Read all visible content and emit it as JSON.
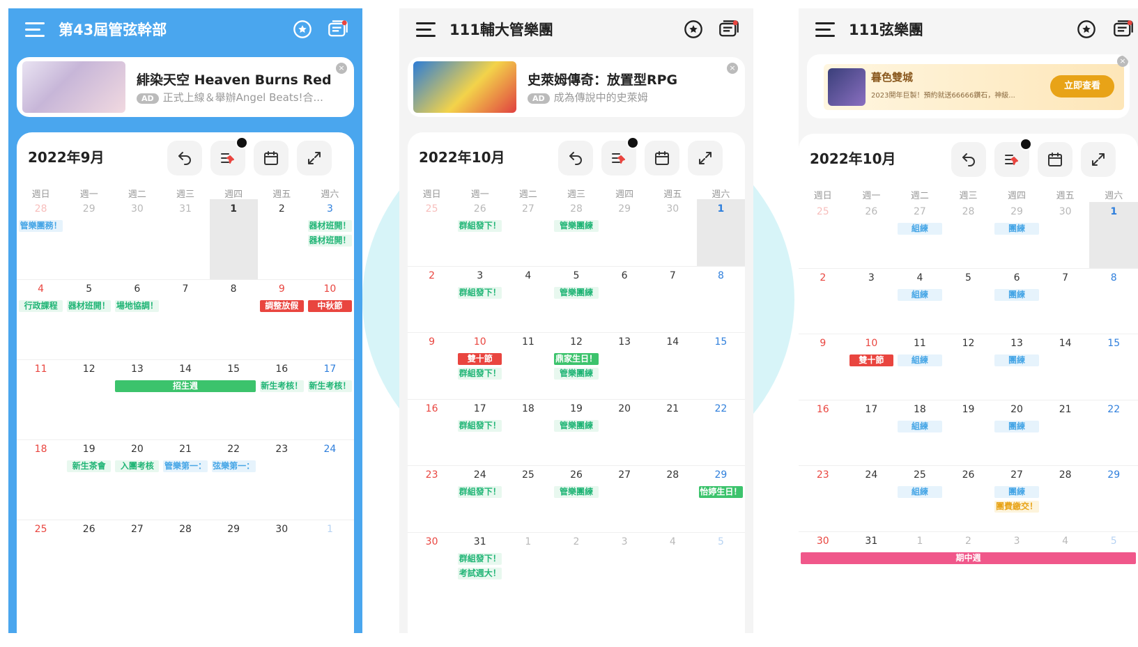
{
  "weekday_labels": [
    "週日",
    "週一",
    "週二",
    "週三",
    "週四",
    "週五",
    "週六"
  ],
  "panels": [
    {
      "title": "第43屆管弦幹部",
      "ad": {
        "title": "緋染天空 Heaven Burns Red",
        "badge": "AD",
        "subtitle": "正式上線＆舉辦Angel Beats!合..."
      },
      "month_label": "2022年9月",
      "days": [
        [
          {
            "d": "28",
            "muted": true,
            "red": true
          },
          {
            "d": "29",
            "muted": true
          },
          {
            "d": "30",
            "muted": true
          },
          {
            "d": "31",
            "muted": true
          },
          {
            "d": "1",
            "today": true
          },
          {
            "d": "2"
          },
          {
            "d": "3",
            "blue": true
          }
        ],
        [
          {
            "d": "4",
            "red": true
          },
          {
            "d": "5"
          },
          {
            "d": "6"
          },
          {
            "d": "7"
          },
          {
            "d": "8"
          },
          {
            "d": "9",
            "red": true
          },
          {
            "d": "10",
            "red": true
          }
        ],
        [
          {
            "d": "11",
            "red": true
          },
          {
            "d": "12"
          },
          {
            "d": "13"
          },
          {
            "d": "14"
          },
          {
            "d": "15"
          },
          {
            "d": "16"
          },
          {
            "d": "17",
            "blue": true
          }
        ],
        [
          {
            "d": "18",
            "red": true
          },
          {
            "d": "19"
          },
          {
            "d": "20"
          },
          {
            "d": "21"
          },
          {
            "d": "22"
          },
          {
            "d": "23"
          },
          {
            "d": "24",
            "blue": true
          }
        ],
        [
          {
            "d": "25",
            "red": true
          },
          {
            "d": "26"
          },
          {
            "d": "27"
          },
          {
            "d": "28"
          },
          {
            "d": "29"
          },
          {
            "d": "30"
          },
          {
            "d": "1",
            "muted": true,
            "blue": true
          }
        ]
      ],
      "events": [
        {
          "row": 0,
          "col": 0,
          "span": 1,
          "line": 0,
          "text": "管樂團務！",
          "style": "tb"
        },
        {
          "row": 0,
          "col": 6,
          "span": 1,
          "line": 0,
          "text": "器材班開！",
          "style": "tg"
        },
        {
          "row": 0,
          "col": 6,
          "span": 1,
          "line": 1,
          "text": "器材班開！",
          "style": "tg"
        },
        {
          "row": 1,
          "col": 0,
          "span": 1,
          "line": 0,
          "text": "行政課程",
          "style": "tg"
        },
        {
          "row": 1,
          "col": 1,
          "span": 1,
          "line": 0,
          "text": "器材班開！",
          "style": "tg"
        },
        {
          "row": 1,
          "col": 2,
          "span": 1,
          "line": 0,
          "text": "場地協調！",
          "style": "tg"
        },
        {
          "row": 1,
          "col": 5,
          "span": 1,
          "line": 0,
          "text": "調整放假",
          "style": "tr"
        },
        {
          "row": 1,
          "col": 6,
          "span": 1,
          "line": 0,
          "text": "中秋節",
          "style": "tr"
        },
        {
          "row": 2,
          "col": 2,
          "span": 3,
          "line": 0,
          "text": "招生週",
          "style": "tfg"
        },
        {
          "row": 2,
          "col": 5,
          "span": 1,
          "line": 0,
          "text": "新生考核！",
          "style": "tg"
        },
        {
          "row": 2,
          "col": 6,
          "span": 1,
          "line": 0,
          "text": "新生考核！",
          "style": "tg"
        },
        {
          "row": 3,
          "col": 1,
          "span": 1,
          "line": 0,
          "text": "新生茶會",
          "style": "tg"
        },
        {
          "row": 3,
          "col": 2,
          "span": 1,
          "line": 0,
          "text": "入團考核",
          "style": "tg"
        },
        {
          "row": 3,
          "col": 3,
          "span": 1,
          "line": 0,
          "text": "管樂第一：",
          "style": "tb"
        },
        {
          "row": 3,
          "col": 4,
          "span": 1,
          "line": 0,
          "text": "弦樂第一：",
          "style": "tb"
        }
      ]
    },
    {
      "title": "111輔大管樂團",
      "ad": {
        "title": "史萊姆傳奇：放置型RPG",
        "badge": "AD",
        "subtitle": "成為傳說中的史萊姆"
      },
      "month_label": "2022年10月",
      "days": [
        [
          {
            "d": "25",
            "muted": true,
            "red": true
          },
          {
            "d": "26",
            "muted": true
          },
          {
            "d": "27",
            "muted": true
          },
          {
            "d": "28",
            "muted": true
          },
          {
            "d": "29",
            "muted": true
          },
          {
            "d": "30",
            "muted": true
          },
          {
            "d": "1",
            "today": true,
            "blue": true
          }
        ],
        [
          {
            "d": "2",
            "red": true
          },
          {
            "d": "3"
          },
          {
            "d": "4"
          },
          {
            "d": "5"
          },
          {
            "d": "6"
          },
          {
            "d": "7"
          },
          {
            "d": "8",
            "blue": true
          }
        ],
        [
          {
            "d": "9",
            "red": true
          },
          {
            "d": "10",
            "red": true
          },
          {
            "d": "11"
          },
          {
            "d": "12"
          },
          {
            "d": "13"
          },
          {
            "d": "14"
          },
          {
            "d": "15",
            "blue": true
          }
        ],
        [
          {
            "d": "16",
            "red": true
          },
          {
            "d": "17"
          },
          {
            "d": "18"
          },
          {
            "d": "19"
          },
          {
            "d": "20"
          },
          {
            "d": "21"
          },
          {
            "d": "22",
            "blue": true
          }
        ],
        [
          {
            "d": "23",
            "red": true
          },
          {
            "d": "24"
          },
          {
            "d": "25"
          },
          {
            "d": "26"
          },
          {
            "d": "27"
          },
          {
            "d": "28"
          },
          {
            "d": "29",
            "blue": true
          }
        ],
        [
          {
            "d": "30",
            "red": true
          },
          {
            "d": "31"
          },
          {
            "d": "1",
            "muted": true
          },
          {
            "d": "2",
            "muted": true
          },
          {
            "d": "3",
            "muted": true
          },
          {
            "d": "4",
            "muted": true
          },
          {
            "d": "5",
            "muted": true,
            "blue": true
          }
        ]
      ],
      "events": [
        {
          "row": 0,
          "col": 1,
          "span": 1,
          "line": 0,
          "text": "群組發下！",
          "style": "tg"
        },
        {
          "row": 0,
          "col": 3,
          "span": 1,
          "line": 0,
          "text": "管樂團練",
          "style": "tg"
        },
        {
          "row": 1,
          "col": 1,
          "span": 1,
          "line": 0,
          "text": "群組發下！",
          "style": "tg"
        },
        {
          "row": 1,
          "col": 3,
          "span": 1,
          "line": 0,
          "text": "管樂團練",
          "style": "tg"
        },
        {
          "row": 2,
          "col": 1,
          "span": 1,
          "line": 0,
          "text": "雙十節",
          "style": "tr"
        },
        {
          "row": 2,
          "col": 1,
          "span": 1,
          "line": 1,
          "text": "群組發下！",
          "style": "tg"
        },
        {
          "row": 2,
          "col": 3,
          "span": 1,
          "line": 0,
          "text": "鼎家生日！",
          "style": "tfg"
        },
        {
          "row": 2,
          "col": 3,
          "span": 1,
          "line": 1,
          "text": "管樂團練",
          "style": "tg"
        },
        {
          "row": 3,
          "col": 1,
          "span": 1,
          "line": 0,
          "text": "群組發下！",
          "style": "tg"
        },
        {
          "row": 3,
          "col": 3,
          "span": 1,
          "line": 0,
          "text": "管樂團練",
          "style": "tg"
        },
        {
          "row": 4,
          "col": 1,
          "span": 1,
          "line": 0,
          "text": "群組發下！",
          "style": "tg"
        },
        {
          "row": 4,
          "col": 3,
          "span": 1,
          "line": 0,
          "text": "管樂團練",
          "style": "tg"
        },
        {
          "row": 4,
          "col": 6,
          "span": 1,
          "line": 0,
          "text": "怡婷生日！",
          "style": "tfg"
        },
        {
          "row": 5,
          "col": 1,
          "span": 1,
          "line": 0,
          "text": "群組發下！",
          "style": "tg"
        },
        {
          "row": 5,
          "col": 1,
          "span": 1,
          "line": 1,
          "text": "考試週大！",
          "style": "tg"
        }
      ]
    },
    {
      "title": "111弦樂團",
      "ad": {
        "title": "暮色雙城",
        "subtitle": "2023開年巨製！預約就送66666鑽石，神級...",
        "cta": "立即查看"
      },
      "month_label": "2022年10月",
      "days": [
        [
          {
            "d": "25",
            "muted": true,
            "red": true
          },
          {
            "d": "26",
            "muted": true
          },
          {
            "d": "27",
            "muted": true
          },
          {
            "d": "28",
            "muted": true
          },
          {
            "d": "29",
            "muted": true
          },
          {
            "d": "30",
            "muted": true
          },
          {
            "d": "1",
            "today": true,
            "blue": true
          }
        ],
        [
          {
            "d": "2",
            "red": true
          },
          {
            "d": "3"
          },
          {
            "d": "4"
          },
          {
            "d": "5"
          },
          {
            "d": "6"
          },
          {
            "d": "7"
          },
          {
            "d": "8",
            "blue": true
          }
        ],
        [
          {
            "d": "9",
            "red": true
          },
          {
            "d": "10",
            "red": true
          },
          {
            "d": "11"
          },
          {
            "d": "12"
          },
          {
            "d": "13"
          },
          {
            "d": "14"
          },
          {
            "d": "15",
            "blue": true
          }
        ],
        [
          {
            "d": "16",
            "red": true
          },
          {
            "d": "17"
          },
          {
            "d": "18"
          },
          {
            "d": "19"
          },
          {
            "d": "20"
          },
          {
            "d": "21"
          },
          {
            "d": "22",
            "blue": true
          }
        ],
        [
          {
            "d": "23",
            "red": true
          },
          {
            "d": "24"
          },
          {
            "d": "25"
          },
          {
            "d": "26"
          },
          {
            "d": "27"
          },
          {
            "d": "28"
          },
          {
            "d": "29",
            "blue": true
          }
        ],
        [
          {
            "d": "30",
            "red": true
          },
          {
            "d": "31"
          },
          {
            "d": "1",
            "muted": true
          },
          {
            "d": "2",
            "muted": true
          },
          {
            "d": "3",
            "muted": true
          },
          {
            "d": "4",
            "muted": true
          },
          {
            "d": "5",
            "muted": true,
            "blue": true
          }
        ]
      ],
      "events": [
        {
          "row": 0,
          "col": 2,
          "span": 1,
          "line": 0,
          "text": "組練",
          "style": "tb"
        },
        {
          "row": 0,
          "col": 4,
          "span": 1,
          "line": 0,
          "text": "團練",
          "style": "tb"
        },
        {
          "row": 1,
          "col": 2,
          "span": 1,
          "line": 0,
          "text": "組練",
          "style": "tb"
        },
        {
          "row": 1,
          "col": 4,
          "span": 1,
          "line": 0,
          "text": "團練",
          "style": "tb"
        },
        {
          "row": 2,
          "col": 1,
          "span": 1,
          "line": 0,
          "text": "雙十節",
          "style": "tr"
        },
        {
          "row": 2,
          "col": 2,
          "span": 1,
          "line": 0,
          "text": "組練",
          "style": "tb"
        },
        {
          "row": 2,
          "col": 4,
          "span": 1,
          "line": 0,
          "text": "團練",
          "style": "tb"
        },
        {
          "row": 3,
          "col": 2,
          "span": 1,
          "line": 0,
          "text": "組練",
          "style": "tb"
        },
        {
          "row": 3,
          "col": 4,
          "span": 1,
          "line": 0,
          "text": "團練",
          "style": "tb"
        },
        {
          "row": 4,
          "col": 2,
          "span": 1,
          "line": 0,
          "text": "組練",
          "style": "tb"
        },
        {
          "row": 4,
          "col": 4,
          "span": 1,
          "line": 0,
          "text": "團練",
          "style": "tb"
        },
        {
          "row": 4,
          "col": 4,
          "span": 1,
          "line": 1,
          "text": "團費繳交！",
          "style": "ty"
        },
        {
          "row": 5,
          "col": 0,
          "span": 7,
          "line": 0,
          "text": "期中週",
          "style": "tp"
        }
      ]
    }
  ],
  "colors": {
    "panel1_bg": "#4aa6ee",
    "weekend_red": "#e9453f",
    "saturday_blue": "#2f7fdc",
    "event_green": "#21b576",
    "event_blue": "#47a6e6",
    "holiday_red": "#e9453f",
    "exam_pink": "#f0578a"
  },
  "icons": [
    "menu-icon",
    "star-circle-icon",
    "chat-icon",
    "undo-icon",
    "pinned-list-icon",
    "calendar-icon",
    "expand-icon",
    "ad-close-icon"
  ]
}
